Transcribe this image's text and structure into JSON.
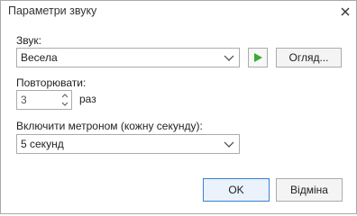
{
  "window": {
    "title": "Параметри звуку"
  },
  "sound": {
    "label": "Звук:",
    "selected": "Весела",
    "browse_label": "Огляд..."
  },
  "repeat": {
    "label": "Повторювати:",
    "value": "3",
    "unit": "раз"
  },
  "metronome": {
    "label": "Включити метроном (кожну секунду):",
    "selected": "5 секунд"
  },
  "footer": {
    "ok_label": "OK",
    "cancel_label": "Відміна"
  },
  "colors": {
    "play_icon": "#3aaa35",
    "accent_border": "#3c7fd0"
  },
  "icons": [
    "close-icon",
    "chevron-down-icon",
    "play-icon",
    "spin-up-icon",
    "spin-down-icon"
  ]
}
